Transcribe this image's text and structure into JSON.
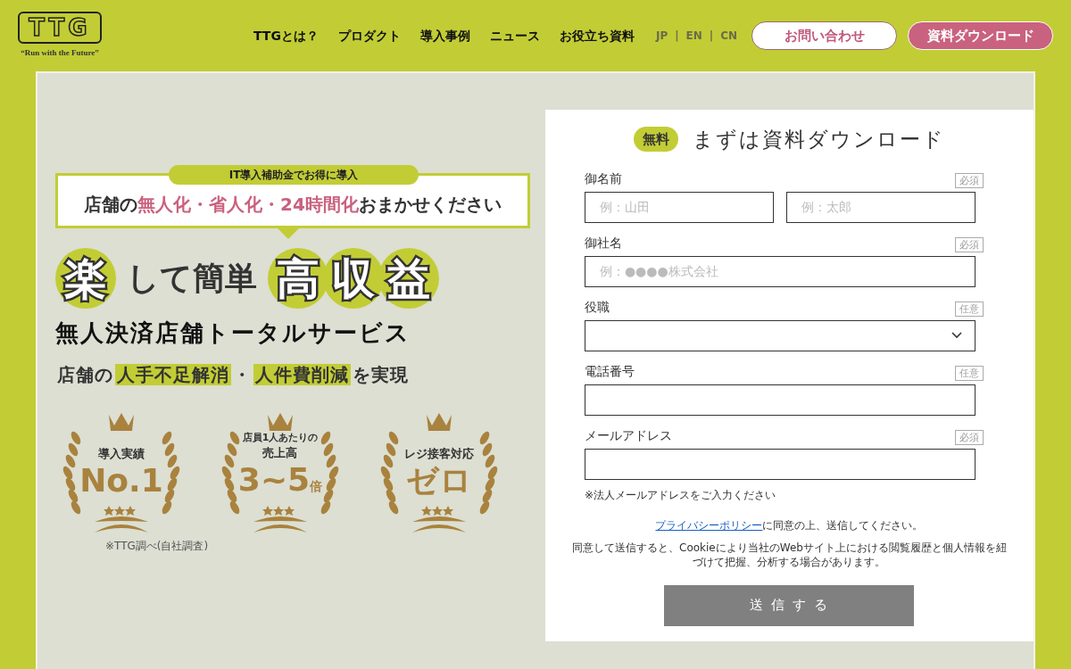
{
  "header": {
    "logo": {
      "text": "TTG",
      "tagline": "“Run with the Future”"
    },
    "nav": [
      "TTGとは？",
      "プロダクト",
      "導入事例",
      "ニュース",
      "お役立ち資料"
    ],
    "language_separators": [
      "|",
      "|"
    ],
    "languages": [
      {
        "label": "JP",
        "selected": false
      },
      {
        "label": "EN",
        "selected": false
      },
      {
        "label": "CN",
        "selected": false
      }
    ],
    "buttons": [
      {
        "label": "お問い合わせ",
        "kind": "outline"
      },
      {
        "label": "資料ダウンロード",
        "kind": "filled"
      }
    ]
  },
  "hero": {
    "tag": "IT導入補助金でお得に導入",
    "callout": [
      {
        "text": "店舗の",
        "highlight": false
      },
      {
        "text": "無人化・省人化・24時間化",
        "highlight": true
      },
      {
        "text": "おまかせください",
        "highlight": false
      }
    ],
    "headline": [
      {
        "text": "楽",
        "highlight": true
      },
      {
        "text": "して簡単",
        "highlight": false
      },
      {
        "text": "高収益",
        "highlight": true
      }
    ],
    "subtitle": "無人決済店舗トータルサービス",
    "benefit": [
      {
        "text": "店舗の",
        "highlight": false
      },
      {
        "text": "人手不足解消",
        "highlight": true
      },
      {
        "text": "・",
        "highlight": false
      },
      {
        "text": "人件費削減",
        "highlight": true
      },
      {
        "text": "を実現",
        "highlight": false
      }
    ],
    "awards": [
      {
        "label": "導入実績",
        "value": "No.1"
      },
      {
        "caption": "店員1人あたりの",
        "label": "売上高",
        "value": "3~5",
        "suffix": "倍"
      },
      {
        "label": "レジ接客対応",
        "value": "ゼロ"
      }
    ],
    "footnote": "※TTG調べ(自社調査)"
  },
  "form": {
    "badge": "無料",
    "title": "まずは資料ダウンロード",
    "fields": [
      {
        "kind": "pair",
        "label": "御名前",
        "requirement": "必須",
        "placeholders": [
          "例：山田",
          "例：太郎"
        ]
      },
      {
        "kind": "text",
        "label": "御社名",
        "requirement": "必須",
        "placeholder": "例：●●●●株式会社"
      },
      {
        "kind": "select",
        "label": "役職",
        "requirement": "任意"
      },
      {
        "kind": "text",
        "label": "電話番号",
        "requirement": "任意"
      },
      {
        "kind": "text",
        "label": "メールアドレス",
        "requirement": "必須",
        "note": "※法人メールアドレスをご入力ください"
      }
    ],
    "privacy_link": "プライバシーポリシー",
    "privacy_text": "に同意の上、送信してください。",
    "cookie_notice": "同意して送信すると、Cookieにより当社のWebサイト上における閲覧履歴と個人情報を紐づけて把握、分析する場合があります。",
    "submit": "送 信 す る"
  }
}
